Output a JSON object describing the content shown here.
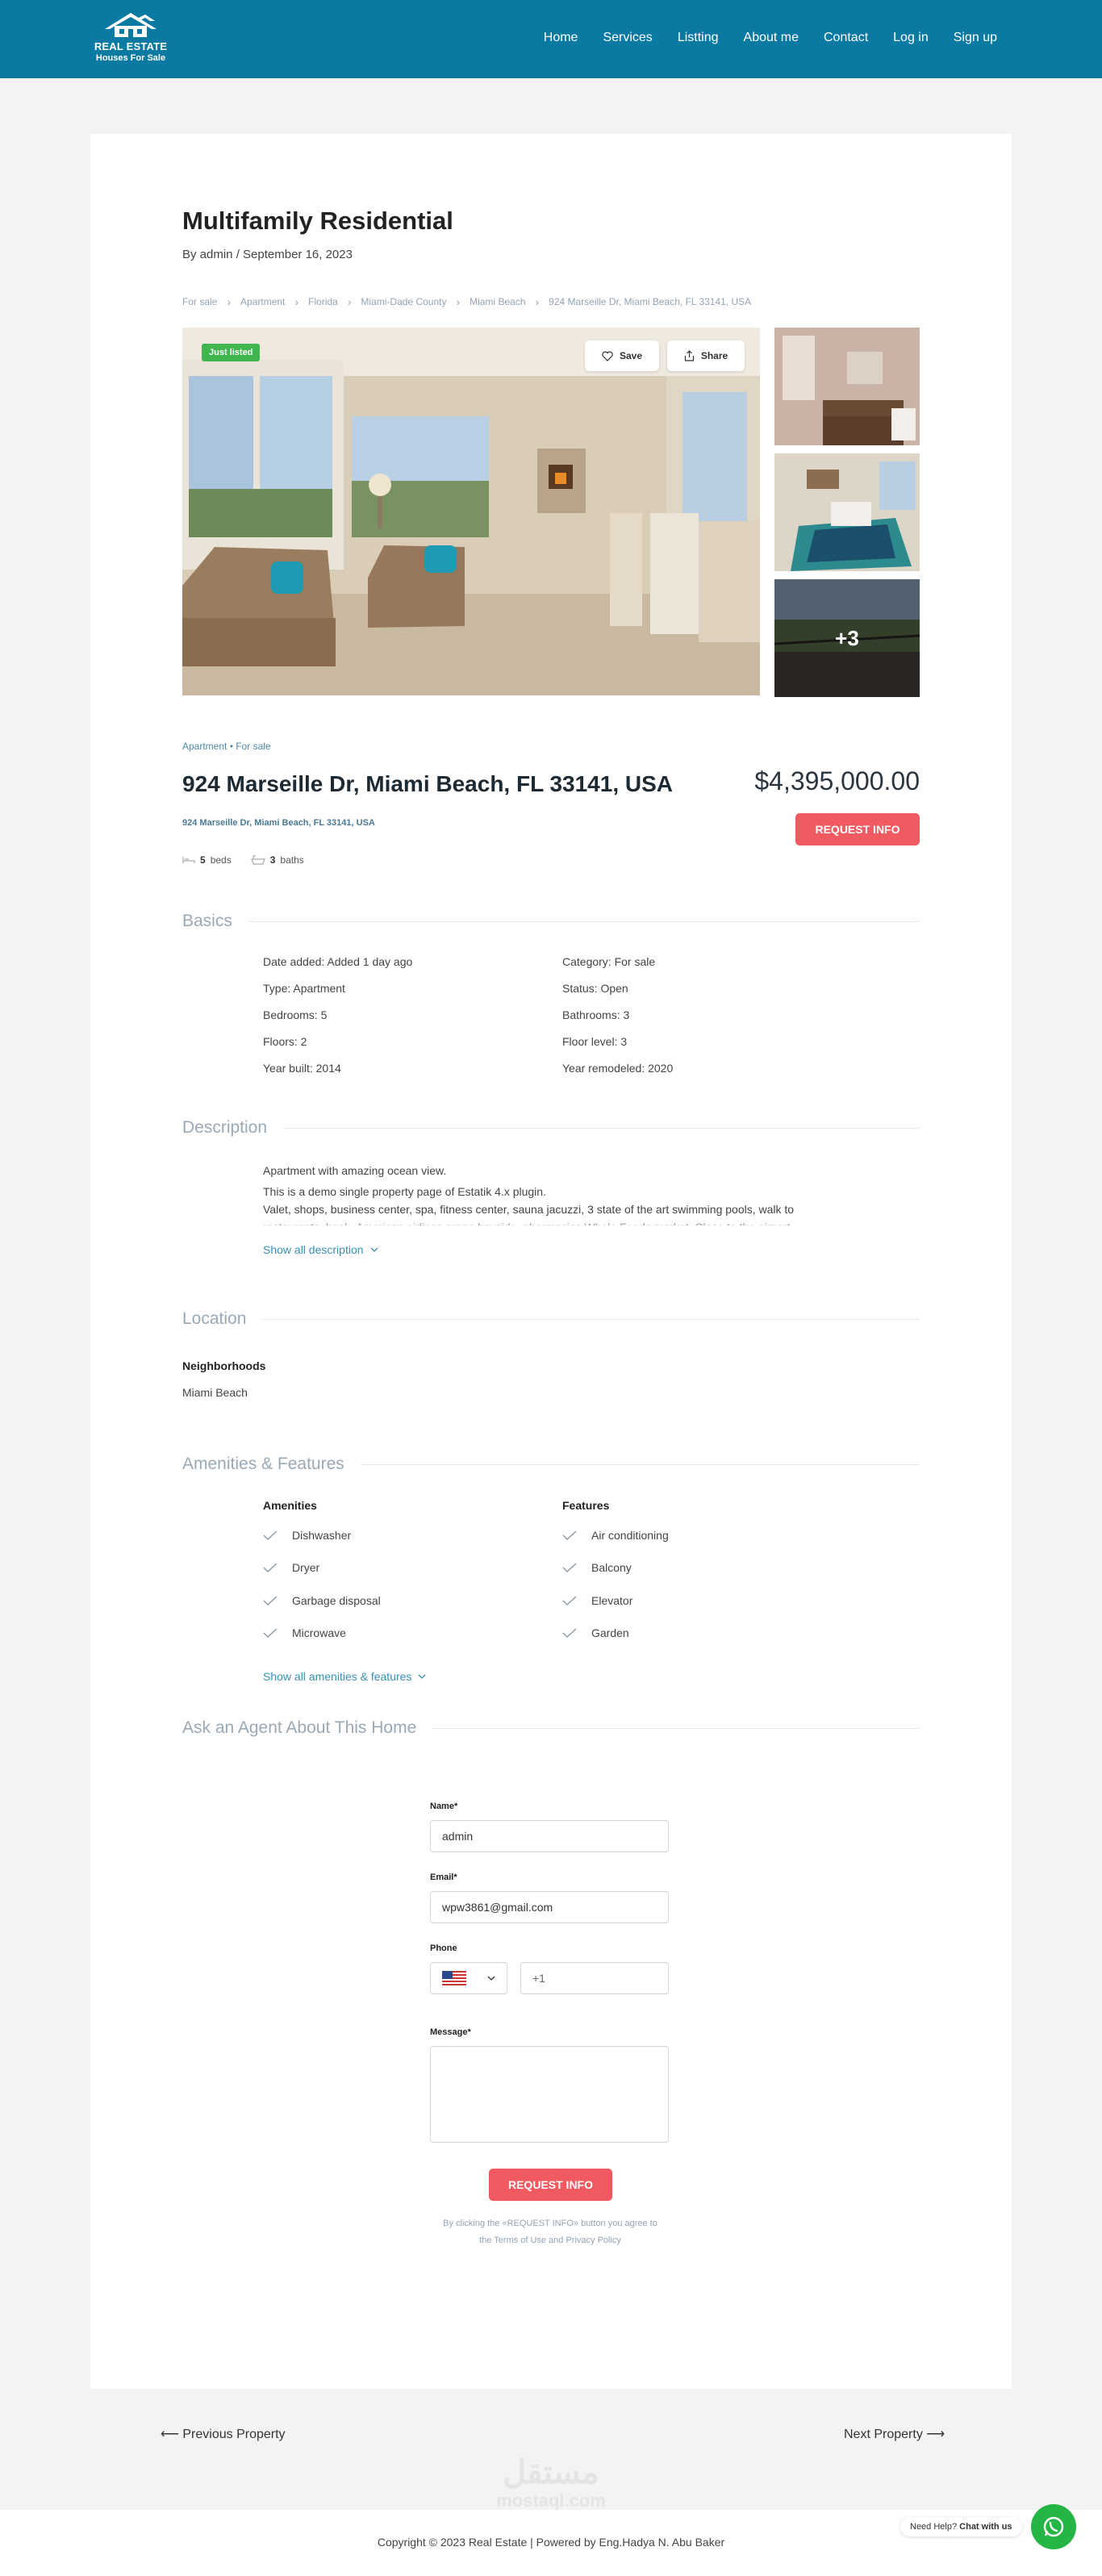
{
  "brand": {
    "line1": "REAL ESTATE",
    "line2": "Houses For Sale"
  },
  "nav": [
    "Home",
    "Services",
    "Listting",
    "About me",
    "Contact",
    "Log in",
    "Sign up"
  ],
  "post": {
    "title": "Multifamily Residential",
    "byline": "By admin / September 16, 2023"
  },
  "breadcrumbs": [
    "For sale",
    "Apartment",
    "Florida",
    "Miami-Dade County",
    "Miami Beach",
    "924 Marseille Dr, Miami Beach, FL 33141, USA"
  ],
  "gallery": {
    "badge": "Just listed",
    "save": "Save",
    "share": "Share",
    "more": "+3"
  },
  "listing": {
    "tags": "Apartment • For sale",
    "address": "924 Marseille Dr, Miami Beach, FL 33141, USA",
    "address_sub": "924 Marseille Dr, Miami Beach, FL 33141, USA",
    "price": "$4,395,000.00",
    "request_button": "REQUEST INFO",
    "beds_num": "5",
    "beds_label": "beds",
    "baths_num": "3",
    "baths_label": "baths"
  },
  "basics": {
    "title": "Basics",
    "left": [
      "Date added: Added 1 day ago",
      "Type: Apartment",
      "Bedrooms: 5",
      "Floors: 2",
      "Year built: 2014"
    ],
    "right": [
      "Category: For sale",
      "Status: Open",
      "Bathrooms: 3",
      "Floor level: 3",
      "Year remodeled: 2020"
    ]
  },
  "description": {
    "title": "Description",
    "p1": "Apartment with amazing ocean view.",
    "p2": "This is a demo single property page of Estatik 4.x plugin.",
    "p3": "Valet, shops, business center, spa, fitness center, sauna jacuzzi, 3 state of the art swimming pools, walk to",
    "p4": "restaurants, bank, American airlines arena bayside, pharmacies Whole Foods market. Close to the airport",
    "show_all": "Show all description"
  },
  "location": {
    "title": "Location",
    "label": "Neighborhoods",
    "value": "Miami Beach"
  },
  "amenities": {
    "title": "Amenities & Features",
    "amenities_head": "Amenities",
    "features_head": "Features",
    "amenities": [
      "Dishwasher",
      "Dryer",
      "Garbage disposal",
      "Microwave"
    ],
    "features": [
      "Air conditioning",
      "Balcony",
      "Elevator",
      "Garden"
    ],
    "show_all": "Show all amenities & features"
  },
  "form": {
    "title": "Ask an Agent About This Home",
    "name_label": "Name*",
    "name_value": "admin",
    "email_label": "Email*",
    "email_value": "wpw3861@gmail.com",
    "phone_label": "Phone",
    "phone_code": "+1",
    "message_label": "Message*",
    "submit": "REQUEST INFO",
    "terms1": "By clicking the «REQUEST INFO» button you agree to",
    "terms2": "the Terms of Use and Privacy Policy"
  },
  "postnav": {
    "prev": "⟵ Previous Property",
    "next": "Next Property ⟶"
  },
  "footer": {
    "copyright": "Copyright © 2023 Real Estate | Powered by Eng.Hadya N. Abu Baker",
    "help_prefix": "Need Help?",
    "help_bold": "Chat with us",
    "watermark_ar": "مستقل",
    "watermark_en": "mostaql.com"
  },
  "colors": {
    "header": "#0a7aa3",
    "accent": "#f25a62",
    "badge": "#3fb44f",
    "link": "#3a8fb0"
  }
}
